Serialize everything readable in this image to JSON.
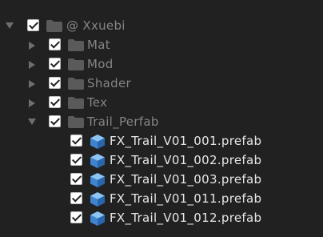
{
  "tree": {
    "root": {
      "label": "@ Xxuebi",
      "expanded": true,
      "checked": true,
      "icon": "folder-icon"
    },
    "folders": [
      {
        "label": "Mat",
        "expanded": false,
        "checked": true,
        "icon": "folder-icon"
      },
      {
        "label": "Mod",
        "expanded": false,
        "checked": true,
        "icon": "folder-icon"
      },
      {
        "label": "Shader",
        "expanded": false,
        "checked": true,
        "icon": "folder-icon"
      },
      {
        "label": "Tex",
        "expanded": false,
        "checked": true,
        "icon": "folder-icon"
      },
      {
        "label": "Trail_Perfab",
        "expanded": true,
        "checked": true,
        "icon": "folder-icon"
      }
    ],
    "files": [
      {
        "label": "FX_Trail_V01_001.prefab",
        "checked": true,
        "icon": "prefab-cube-icon"
      },
      {
        "label": "FX_Trail_V01_002.prefab",
        "checked": true,
        "icon": "prefab-cube-icon"
      },
      {
        "label": "FX_Trail_V01_003.prefab",
        "checked": true,
        "icon": "prefab-cube-icon"
      },
      {
        "label": "FX_Trail_V01_011.prefab",
        "checked": true,
        "icon": "prefab-cube-icon"
      },
      {
        "label": "FX_Trail_V01_012.prefab",
        "checked": true,
        "icon": "prefab-cube-icon"
      }
    ]
  },
  "colors": {
    "background": "#212121",
    "folder": "#5a5a5a",
    "dim_text": "#858585",
    "bright_text": "#e6e6e6",
    "prefab_blue": "#4a90d9"
  }
}
